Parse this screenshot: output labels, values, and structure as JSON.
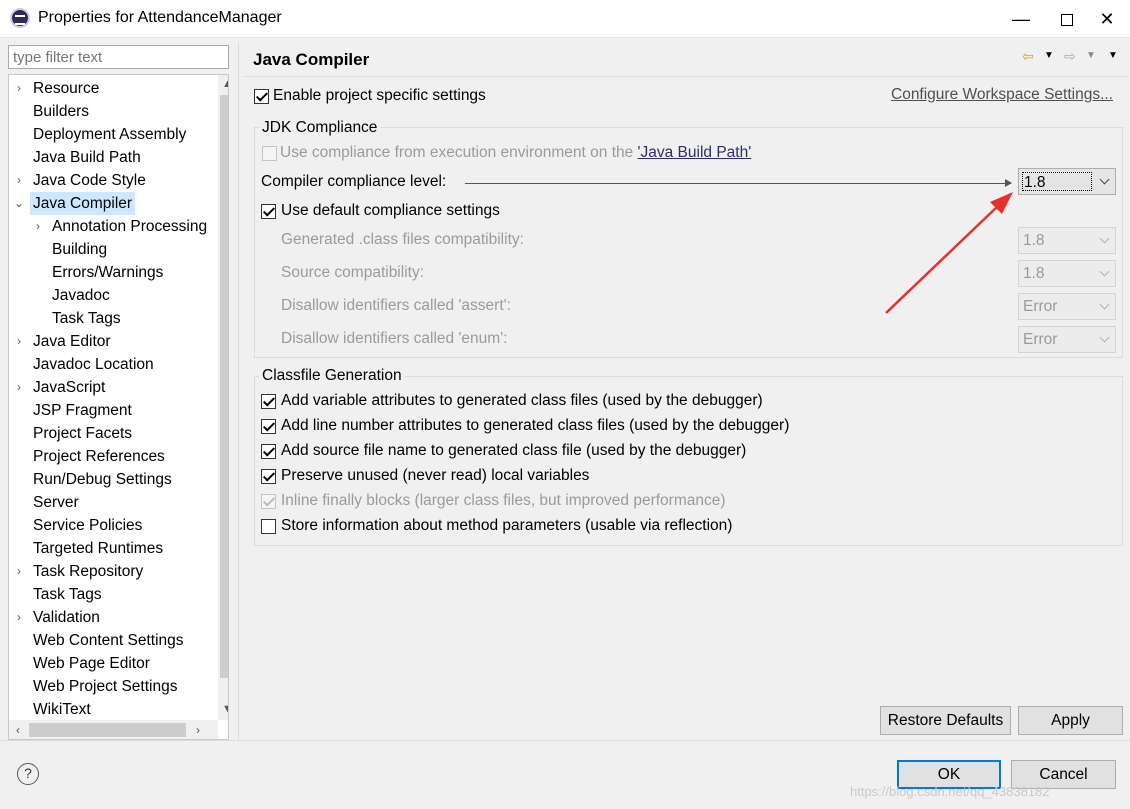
{
  "window": {
    "title": "Properties for AttendanceManager",
    "minimize_glyph": "—",
    "close_glyph": "✕"
  },
  "sidebar": {
    "filter_placeholder": "type filter text",
    "items": [
      {
        "label": "Resource",
        "expandable": true,
        "level": 0
      },
      {
        "label": "Builders",
        "expandable": false,
        "level": 0
      },
      {
        "label": "Deployment Assembly",
        "expandable": false,
        "level": 0
      },
      {
        "label": "Java Build Path",
        "expandable": false,
        "level": 0
      },
      {
        "label": "Java Code Style",
        "expandable": true,
        "level": 0
      },
      {
        "label": "Java Compiler",
        "expandable": true,
        "expanded": true,
        "selected": true,
        "level": 0
      },
      {
        "label": "Annotation Processing",
        "expandable": true,
        "level": 1
      },
      {
        "label": "Building",
        "expandable": false,
        "level": 1
      },
      {
        "label": "Errors/Warnings",
        "expandable": false,
        "level": 1
      },
      {
        "label": "Javadoc",
        "expandable": false,
        "level": 1
      },
      {
        "label": "Task Tags",
        "expandable": false,
        "level": 1
      },
      {
        "label": "Java Editor",
        "expandable": true,
        "level": 0
      },
      {
        "label": "Javadoc Location",
        "expandable": false,
        "level": 0
      },
      {
        "label": "JavaScript",
        "expandable": true,
        "level": 0
      },
      {
        "label": "JSP Fragment",
        "expandable": false,
        "level": 0
      },
      {
        "label": "Project Facets",
        "expandable": false,
        "level": 0
      },
      {
        "label": "Project References",
        "expandable": false,
        "level": 0
      },
      {
        "label": "Run/Debug Settings",
        "expandable": false,
        "level": 0
      },
      {
        "label": "Server",
        "expandable": false,
        "level": 0
      },
      {
        "label": "Service Policies",
        "expandable": false,
        "level": 0
      },
      {
        "label": "Targeted Runtimes",
        "expandable": false,
        "level": 0
      },
      {
        "label": "Task Repository",
        "expandable": true,
        "level": 0
      },
      {
        "label": "Task Tags",
        "expandable": false,
        "level": 0
      },
      {
        "label": "Validation",
        "expandable": true,
        "level": 0
      },
      {
        "label": "Web Content Settings",
        "expandable": false,
        "level": 0
      },
      {
        "label": "Web Page Editor",
        "expandable": false,
        "level": 0
      },
      {
        "label": "Web Project Settings",
        "expandable": false,
        "level": 0
      },
      {
        "label": "WikiText",
        "expandable": false,
        "level": 0
      }
    ]
  },
  "main": {
    "title": "Java Compiler",
    "enable_project_settings": {
      "label": "Enable project specific settings",
      "checked": true
    },
    "configure_workspace_link": "Configure Workspace Settings...",
    "jdk": {
      "group_title": "JDK Compliance",
      "use_ee_prefix": "Use compliance from execution environment on the ",
      "use_ee_link": "'Java Build Path'",
      "use_ee_checked": false,
      "compliance_label": "Compiler compliance level:",
      "compliance_value": "1.8",
      "use_default": {
        "label": "Use default compliance settings",
        "checked": true
      },
      "generated_label": "Generated .class files compatibility:",
      "generated_value": "1.8",
      "source_label": "Source compatibility:",
      "source_value": "1.8",
      "assert_label": "Disallow identifiers called 'assert':",
      "assert_value": "Error",
      "enum_label": "Disallow identifiers called 'enum':",
      "enum_value": "Error"
    },
    "classfile": {
      "group_title": "Classfile Generation",
      "options": [
        {
          "label": "Add variable attributes to generated class files (used by the debugger)",
          "checked": true,
          "disabled": false
        },
        {
          "label": "Add line number attributes to generated class files (used by the debugger)",
          "checked": true,
          "disabled": false
        },
        {
          "label": "Add source file name to generated class file (used by the debugger)",
          "checked": true,
          "disabled": false
        },
        {
          "label": "Preserve unused (never read) local variables",
          "checked": true,
          "disabled": false
        },
        {
          "label": "Inline finally blocks (larger class files, but improved performance)",
          "checked": true,
          "disabled": true
        },
        {
          "label": "Store information about method parameters (usable via reflection)",
          "checked": false,
          "disabled": false
        }
      ]
    },
    "restore_defaults": "Restore Defaults",
    "apply": "Apply"
  },
  "footer": {
    "help": "?",
    "ok": "OK",
    "cancel": "Cancel",
    "watermark": "https://blog.csdn.net/qq_43838182"
  },
  "colors": {
    "selection": "#cce8ff",
    "annotation_arrow": "#e8302a",
    "default_button_border": "#0078d7"
  }
}
